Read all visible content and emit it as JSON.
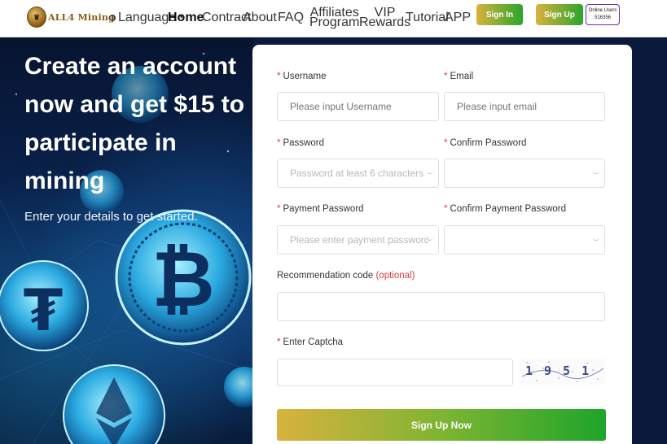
{
  "header": {
    "logo_text": "ALL4 Mining",
    "nav": {
      "language": "Language",
      "home": "Home",
      "contract": "Contract",
      "about": "About",
      "faq": "FAQ",
      "affiliates_line1": "Affiliates",
      "affiliates_line2": "Program",
      "vip_line1": "VIP",
      "vip_line2": "Rewards",
      "tutorial": "Tutorial",
      "app": "APP"
    },
    "sign_in": "Sign In",
    "sign_up": "Sign Up",
    "online_label": "Online Users",
    "online_count": "516356"
  },
  "hero": {
    "title": "Create an account now and get $15 to participate in mining",
    "subtitle": "Enter your details to get started."
  },
  "form": {
    "username_label": "Username",
    "username_placeholder": "Please input Username",
    "email_label": "Email",
    "email_placeholder": "Please input email",
    "password_label": "Password",
    "password_placeholder": "Password at least 6 characters",
    "confirm_password_label": "Confirm Password",
    "payment_password_label": "Payment Password",
    "payment_password_placeholder": "Please enter payment password",
    "confirm_payment_password_label": "Confirm Payment Password",
    "recommendation_label": "Recommendation code",
    "recommendation_optional": "(optional)",
    "captcha_label": "Enter Captcha",
    "captcha_value": "1951",
    "required_mark": "*",
    "submit": "Sign Up Now"
  },
  "colors": {
    "gradient_start": "#d9b23e",
    "gradient_end": "#1ea52a",
    "required": "#e23b3b"
  }
}
